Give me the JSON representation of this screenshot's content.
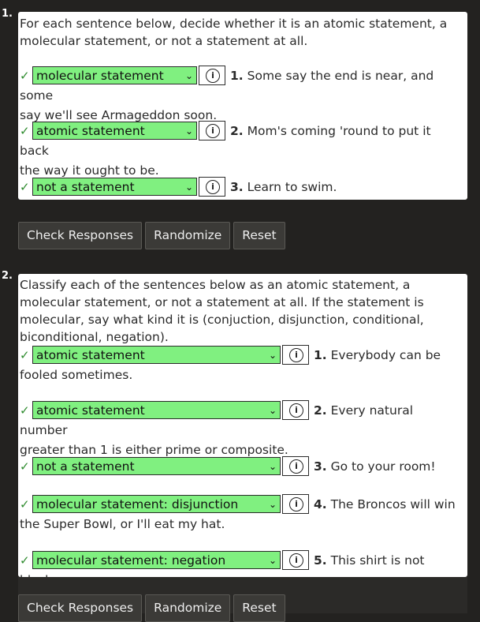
{
  "exercises": [
    {
      "number": "1.",
      "prompt": "For each sentence below, decide whether it is an atomic statement, a molecular statement, or not a statement at all.",
      "questions": [
        {
          "check": "✓",
          "answer": "molecular statement",
          "num": "1.",
          "text_line1": "Some say the end is near, and some",
          "text_line2": "say we'll see Armageddon soon."
        },
        {
          "check": "✓",
          "answer": "atomic statement",
          "num": "2.",
          "text_line1": "Mom's coming 'round to put it back",
          "text_line2": "the way it ought to be."
        },
        {
          "check": "✓",
          "answer": "not a statement",
          "num": "3.",
          "text_line1": "Learn to swim.",
          "text_line2": ""
        }
      ],
      "buttons": {
        "check": "Check Responses",
        "randomize": "Randomize",
        "reset": "Reset"
      }
    },
    {
      "number": "2.",
      "prompt": "Classify each of the sentences below as an atomic statement, a molecular statement, or not a statement at all. If the statement is molecular, say what kind it is (conjuction, disjunction, conditional, biconditional, negation).",
      "questions": [
        {
          "check": "✓",
          "answer": "atomic statement",
          "num": "1.",
          "text_line1": "Everybody can be",
          "text_line2": "fooled sometimes."
        },
        {
          "check": "✓",
          "answer": "atomic statement",
          "num": "2.",
          "text_line1": "Every natural number",
          "text_line2": "greater than 1 is either prime or composite."
        },
        {
          "check": "✓",
          "answer": "not a statement",
          "num": "3.",
          "text_line1": "Go to your room!",
          "text_line2": ""
        },
        {
          "check": "✓",
          "answer": "molecular statement: disjunction",
          "num": "4.",
          "text_line1": "The Broncos will win",
          "text_line2": "the Super Bowl, or I'll eat my hat."
        },
        {
          "check": "✓",
          "answer": "molecular statement: negation",
          "num": "5.",
          "text_line1": "This shirt is not black.",
          "text_line2": ""
        }
      ],
      "buttons": {
        "check": "Check Responses",
        "randomize": "Randomize",
        "reset": "Reset"
      }
    }
  ],
  "icons": {
    "dropdown": "chevron-down-icon",
    "info": "info-icon",
    "correct": "checkmark-icon"
  },
  "colors": {
    "correct_bg": "#80f080",
    "check": "#2e8b2e",
    "page_bg": "#232220"
  }
}
